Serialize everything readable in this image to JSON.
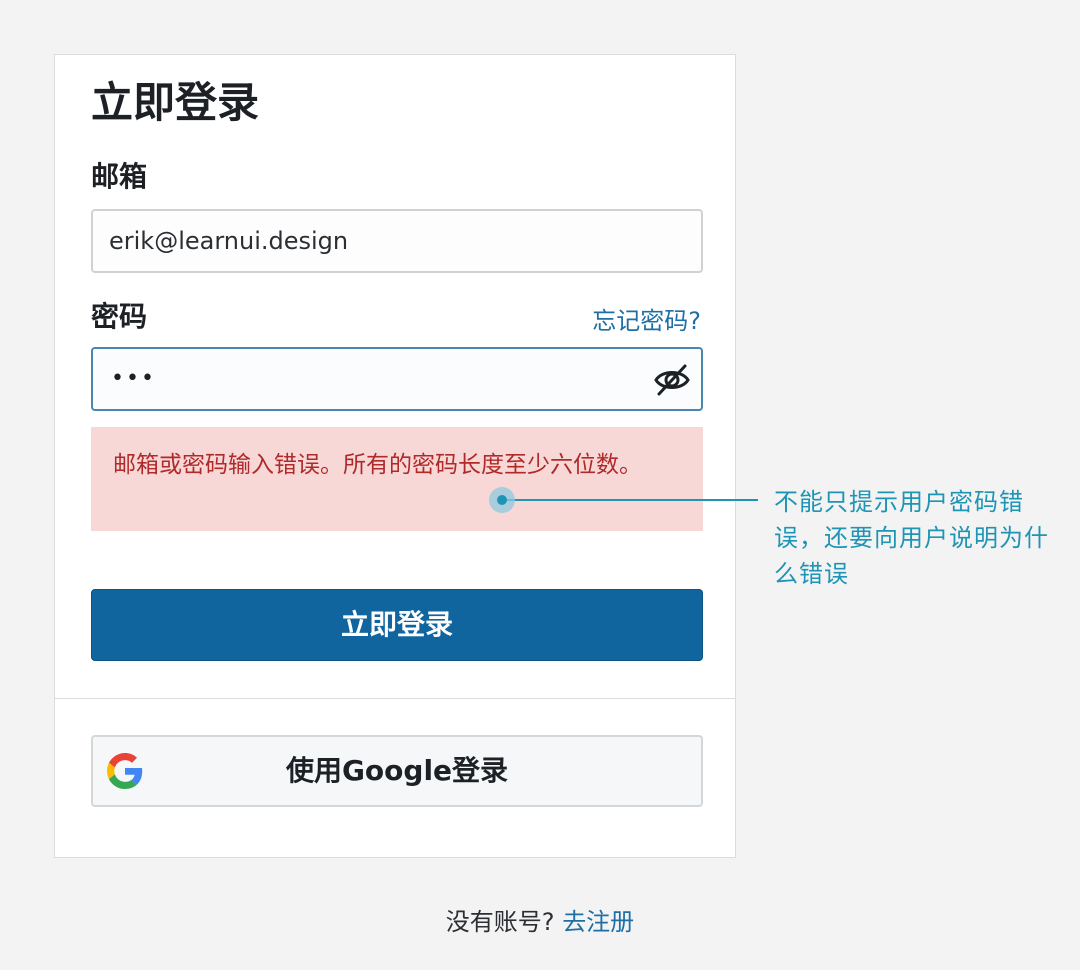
{
  "login": {
    "title": "立即登录",
    "email_label": "邮箱",
    "email_value": "erik@learnui.design",
    "password_label": "密码",
    "forgot_password": "忘记密码?",
    "password_masked": "•••",
    "error_message": "邮箱或密码输入错误。所有的密码长度至少六位数。",
    "submit_label": "立即登录",
    "google_label": "使用Google登录"
  },
  "footer": {
    "prompt": "没有账号?",
    "register_link": "去注册"
  },
  "annotation": {
    "text": "不能只提示用户密码错误，还要向用户说明为什么错误"
  },
  "colors": {
    "primary_button": "#11659f",
    "link": "#1d6fa5",
    "error_bg": "#f8d7d7",
    "error_text": "#b02a2a",
    "annotation": "#1e95b5"
  },
  "icons": {
    "password_toggle": "eye-off-icon",
    "google": "google-logo-icon"
  }
}
